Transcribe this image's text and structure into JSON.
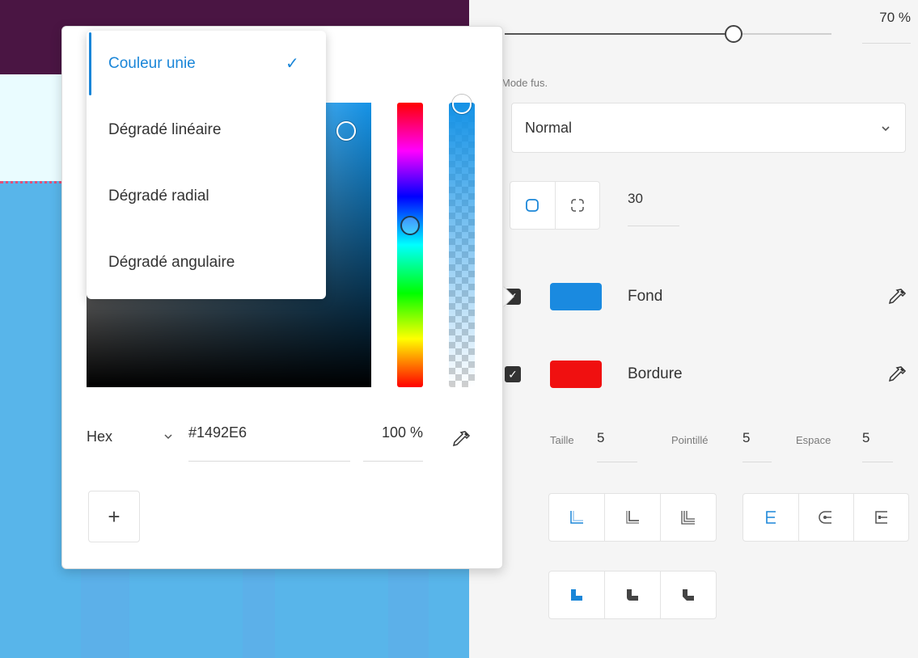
{
  "panel": {
    "opacity_value": "70 %",
    "opacity_level": 0.7,
    "blend_label": "Mode fus.",
    "blend_value": "Normal",
    "corner_radius": "30",
    "fill": {
      "label": "Fond",
      "color": "#1a8ae0"
    },
    "border": {
      "label": "Bordure",
      "color": "#f01010",
      "checked": true
    },
    "stroke": {
      "size_label": "Taille",
      "size_value": "5",
      "dash_label": "Pointillé",
      "dash_value": "5",
      "gap_label": "Espace",
      "gap_value": "5"
    }
  },
  "picker": {
    "format_label": "Hex",
    "hex_value": "#1492E6",
    "opacity_value": "100 %",
    "add_label": "+",
    "current_color": "#1492e6"
  },
  "menu": {
    "items": [
      {
        "label": "Couleur unie",
        "selected": true
      },
      {
        "label": "Dégradé linéaire",
        "selected": false
      },
      {
        "label": "Dégradé radial",
        "selected": false
      },
      {
        "label": "Dégradé angulaire",
        "selected": false
      }
    ],
    "check_mark": "✓"
  },
  "colors": {
    "accent": "#1a86d8",
    "canvas_fill": "#58b5ea",
    "canvas_top": "#4a1543"
  }
}
